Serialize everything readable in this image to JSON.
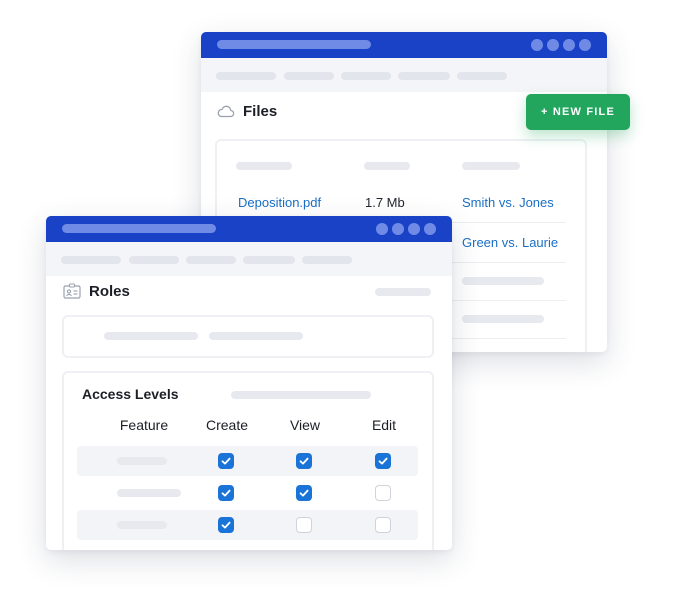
{
  "files_window": {
    "title": "Files",
    "new_file_label": "+ NEW FILE",
    "rows": [
      {
        "name": "Deposition.pdf",
        "size": "1.7 Mb",
        "case": "Smith vs. Jones"
      },
      {
        "case": "Green vs. Laurie"
      }
    ]
  },
  "roles_window": {
    "title": "Roles",
    "access_levels": {
      "title": "Access Levels",
      "columns": [
        "Feature",
        "Create",
        "View",
        "Edit"
      ],
      "rows": [
        {
          "create": true,
          "view": true,
          "edit": true
        },
        {
          "create": true,
          "view": true,
          "edit": false
        },
        {
          "create": true,
          "view": false,
          "edit": false
        }
      ]
    }
  },
  "colors": {
    "titlebar": "#1a42c6",
    "accent_green": "#22a65d",
    "link_blue": "#1a6fc4",
    "checkbox_blue": "#1a73d6"
  },
  "icons": {
    "files": "cloud-icon",
    "roles": "id-badge-icon",
    "checkbox": "check-icon"
  }
}
